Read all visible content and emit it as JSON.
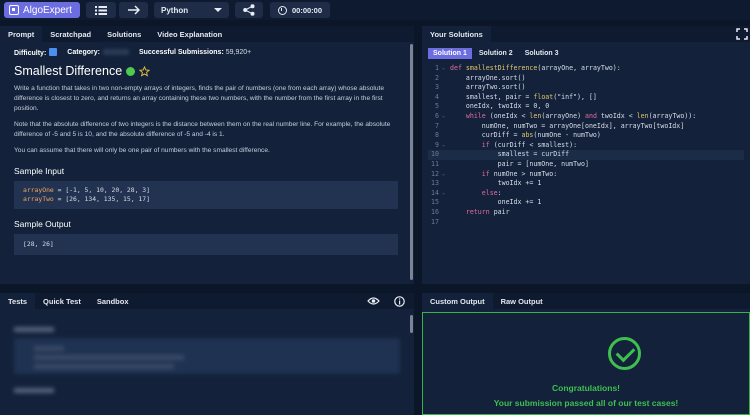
{
  "topbar": {
    "logo": "AlgoExpert",
    "language": "Python",
    "timer": "00:00:00"
  },
  "prompt": {
    "tabs": [
      "Prompt",
      "Scratchpad",
      "Solutions",
      "Video Explanation"
    ],
    "difficulty_label": "Difficulty:",
    "category_label": "Category:",
    "submissions_label": "Successful Submissions:",
    "submissions_value": "59,920+",
    "title": "Smallest Difference",
    "paragraphs": [
      "Write a function that takes in two non-empty arrays of integers, finds the pair of numbers (one from each array) whose absolute difference is closest to zero, and returns an array containing these two numbers, with the number from the first array in the first position.",
      "Note that the absolute difference of two integers is the distance between them on the real number line. For example, the absolute difference of -5 and 5 is 10, and the absolute difference of -5 and -4 is 1.",
      "You can assume that there will only be one pair of numbers with the smallest difference."
    ],
    "sample_input_heading": "Sample Input",
    "sample_input": [
      {
        "name": "arrayOne",
        "value": " = [-1, 5, 10, 20, 28, 3]"
      },
      {
        "name": "arrayTwo",
        "value": " = [26, 134, 135, 15, 17]"
      }
    ],
    "sample_output_heading": "Sample Output",
    "sample_output": "[28, 26]"
  },
  "solutions": {
    "panel_tab": "Your Solutions",
    "tabs": [
      "Solution 1",
      "Solution 2",
      "Solution 3"
    ],
    "code": [
      "def smallestDifference(arrayOne, arrayTwo):",
      "    arrayOne.sort()",
      "    arrayTwo.sort()",
      "    smallest, pair = float(\"inf\"), []",
      "    oneIdx, twoIdx = 0, 0",
      "    while (oneIdx < len(arrayOne) and twoIdx < len(arrayTwo)):",
      "        numOne, numTwo = arrayOne[oneIdx], arrayTwo[twoIdx]",
      "        curDiff = abs(numOne - numTwo)",
      "        if (curDiff < smallest):",
      "            smallest = curDiff",
      "            pair = [numOne, numTwo]",
      "        if numOne > numTwo:",
      "            twoIdx += 1",
      "        else:",
      "            oneIdx += 1",
      "    return pair",
      ""
    ]
  },
  "tests": {
    "tabs": [
      "Tests",
      "Quick Test",
      "Sandbox"
    ]
  },
  "output": {
    "tabs": [
      "Custom Output",
      "Raw Output"
    ],
    "line1": "Congratulations!",
    "line2": "Your submission passed all of our test cases!"
  },
  "colors": {
    "accent": "#6c6de0",
    "success": "#3fbf4f",
    "panel": "#13223a",
    "background": "#0b1628"
  }
}
